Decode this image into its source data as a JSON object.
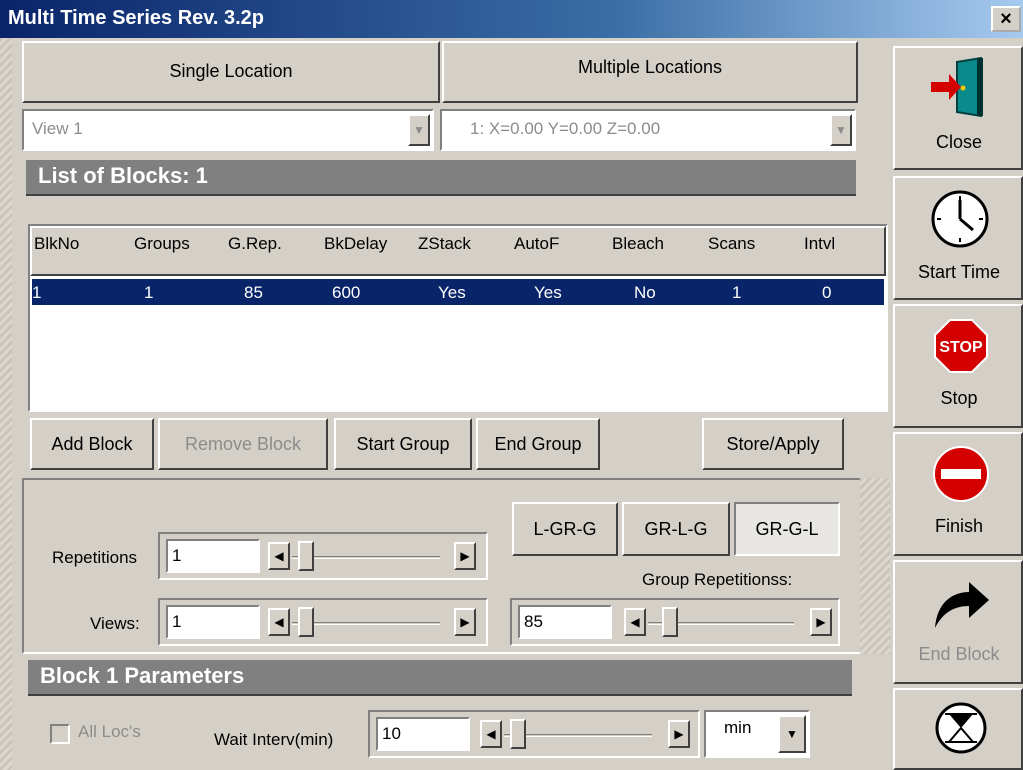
{
  "window": {
    "title": "Multi Time Series Rev. 3.2p",
    "close_glyph": "×"
  },
  "tabs": {
    "single": "Single Location",
    "multiple": "Multiple Locations"
  },
  "combos": {
    "view": "View 1",
    "location": "1: X=0.00 Y=0.00 Z=0.00"
  },
  "list": {
    "header": "List of Blocks: 1",
    "columns": [
      "BlkNo",
      "Groups",
      "G.Rep.",
      "BkDelay",
      "ZStack",
      "AutoF",
      "Bleach",
      "Scans",
      "Intvl"
    ],
    "rows": [
      [
        "1",
        "1",
        "85",
        "600",
        "Yes",
        "Yes",
        "No",
        "1",
        "0"
      ]
    ]
  },
  "block_buttons": {
    "add": "Add Block",
    "remove": "Remove Block",
    "start_group": "Start Group",
    "end_group": "End Group",
    "store_apply": "Store/Apply"
  },
  "settings": {
    "repetitions_label": "Repetitions",
    "repetitions_value": "1",
    "views_label": "Views:",
    "views_value": "1",
    "order_buttons": [
      "L-GR-G",
      "GR-L-G",
      "GR-G-L"
    ],
    "group_reps_label": "Group Repetitionss:",
    "group_reps_value": "85"
  },
  "params": {
    "header": "Block 1 Parameters",
    "all_locs": "All Loc's",
    "wait_label": "Wait Interv(min)",
    "wait_value": "10",
    "unit": "min"
  },
  "side": {
    "close": "Close",
    "start_time": "Start Time",
    "stop_icon_text": "STOP",
    "stop": "Stop",
    "finish": "Finish",
    "end_block": "End Block"
  },
  "colors": {
    "selection": "#0a246a",
    "face": "#d4d0c8",
    "stop_red": "#d40000"
  }
}
